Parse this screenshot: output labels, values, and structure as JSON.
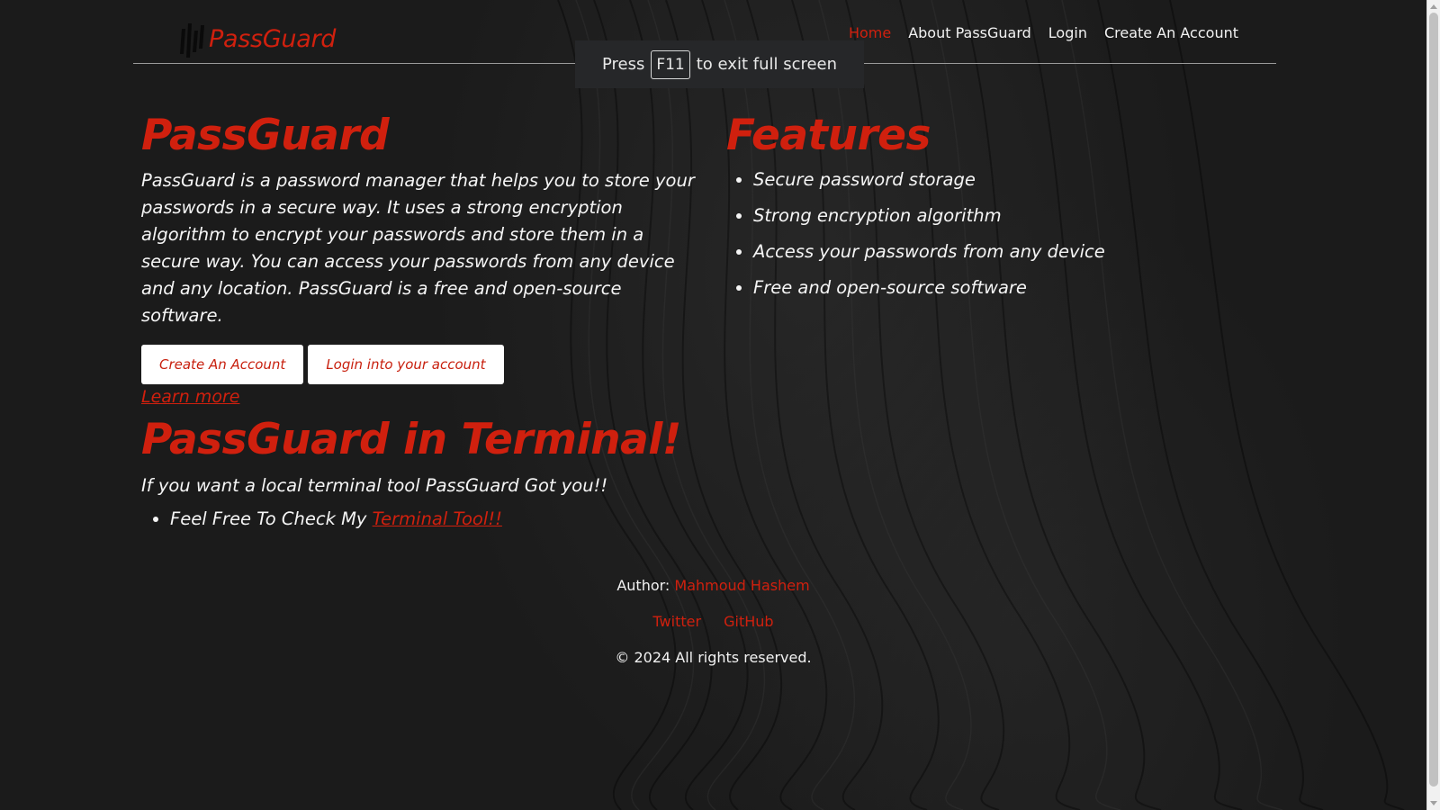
{
  "logo": {
    "text": "PassGuard",
    "icon": "passguard-bars-icon"
  },
  "nav": {
    "items": [
      {
        "label": "Home",
        "active": true
      },
      {
        "label": "About PassGuard",
        "active": false
      },
      {
        "label": "Login",
        "active": false
      },
      {
        "label": "Create An Account",
        "active": false
      }
    ]
  },
  "fullscreen_toast": {
    "prefix": "Press",
    "key": "F11",
    "suffix": "to exit full screen"
  },
  "hero": {
    "title": "PassGuard",
    "description": "PassGuard is a password manager that helps you to store your passwords in a secure way. It uses a strong encryption algorithm to encrypt your passwords and store them in a secure way. You can access your passwords from any device and any location. PassGuard is a free and open-source software.",
    "create_button": "Create An Account",
    "login_button": "Login into your account",
    "learn_more": "Learn more"
  },
  "features": {
    "title": "Features",
    "items": [
      "Secure password storage",
      "Strong encryption algorithm",
      "Access your passwords from any device",
      "Free and open-source software"
    ]
  },
  "terminal": {
    "title": "PassGuard in Terminal!",
    "subtitle": "If you want a local terminal tool PassGuard Got you!!",
    "item_prefix": "Feel Free To Check My",
    "item_link": "Terminal Tool!!"
  },
  "footer": {
    "author_label": "Author:",
    "author_name": "Mahmoud Hashem",
    "links": [
      "Twitter",
      "GitHub"
    ],
    "copyright": "© 2024 All rights reserved."
  },
  "colors": {
    "accent": "#d0200e",
    "background": "#1b1b1b",
    "text": "#f5f5f5"
  }
}
